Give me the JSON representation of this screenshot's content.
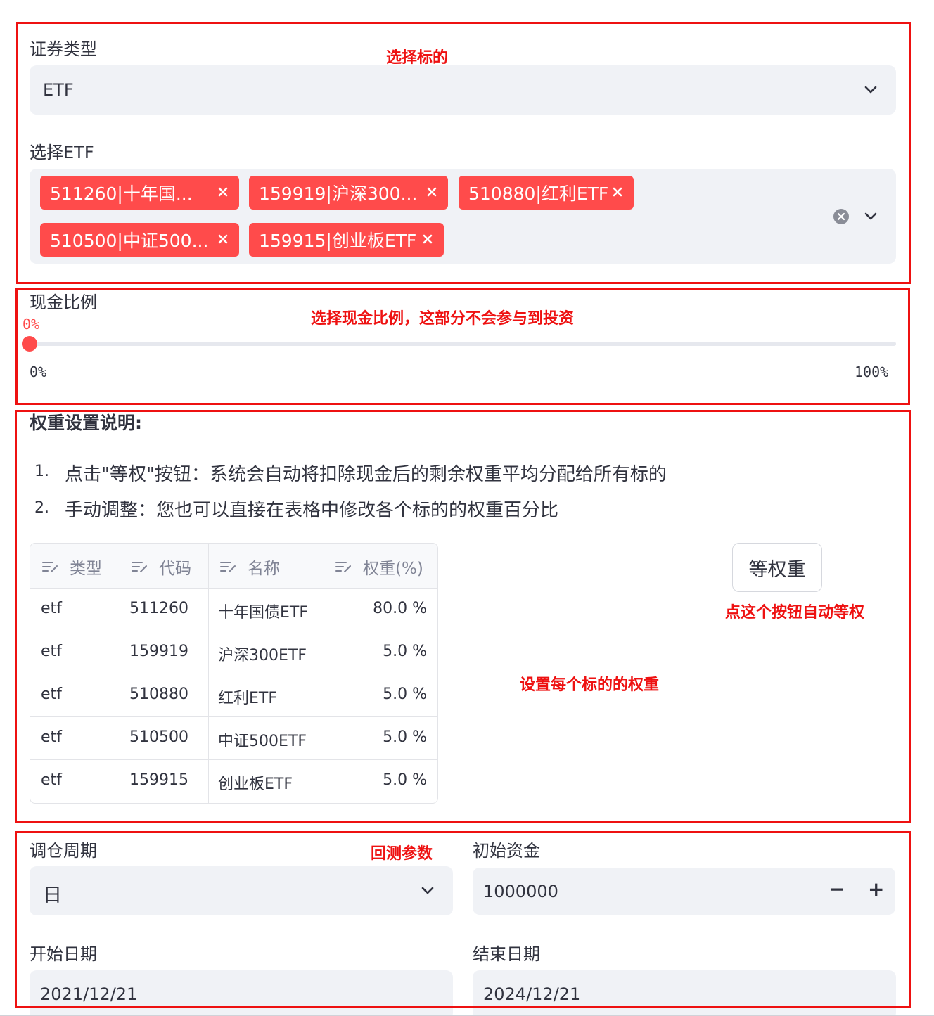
{
  "security_type": {
    "label": "证券类型",
    "value": "ETF"
  },
  "select_etf": {
    "label": "选择ETF",
    "tags": [
      "511260|十年国...",
      "159919|沪深300...",
      "510880|红利ETF",
      "510500|中证500...",
      "159915|创业板ETF"
    ]
  },
  "cash_ratio": {
    "label": "现金比例",
    "current": "0%",
    "min": "0%",
    "max": "100%",
    "value_fraction": 0
  },
  "weight_help": {
    "title": "权重设置说明:",
    "items": [
      "点击\"等权\"按钮：系统会自动将扣除现金后的剩余权重平均分配给所有标的",
      "手动调整：您也可以直接在表格中修改各个标的的权重百分比"
    ],
    "numbers": [
      "1.",
      "2."
    ]
  },
  "weight_table": {
    "columns": [
      "类型",
      "代码",
      "名称",
      "权重(%)"
    ],
    "rows": [
      {
        "type": "etf",
        "code": "511260",
        "name": "十年国债ETF",
        "weight": "80.0 %"
      },
      {
        "type": "etf",
        "code": "159919",
        "name": "沪深300ETF",
        "weight": "5.0 %"
      },
      {
        "type": "etf",
        "code": "510880",
        "name": "红利ETF",
        "weight": "5.0 %"
      },
      {
        "type": "etf",
        "code": "510500",
        "name": "中证500ETF",
        "weight": "5.0 %"
      },
      {
        "type": "etf",
        "code": "159915",
        "name": "创业板ETF",
        "weight": "5.0 %"
      }
    ]
  },
  "equal_weight_button": "等权重",
  "rebalance": {
    "label": "调仓周期",
    "value": "日"
  },
  "initial_capital": {
    "label": "初始资金",
    "value": "1000000",
    "minus": "−",
    "plus": "+"
  },
  "start_date": {
    "label": "开始日期",
    "value": "2021/12/21"
  },
  "end_date": {
    "label": "结束日期",
    "value": "2024/12/21"
  },
  "annotations": {
    "select_target": "选择标的",
    "cash_note": "选择现金比例，这部分不会参与到投资",
    "equal_note": "点这个按钮自动等权",
    "set_weight": "设置每个标的的权重",
    "backtest_params": "回测参数"
  },
  "colors": {
    "accent": "#ff4b4b",
    "annotation": "#ee1111",
    "field_bg": "#f0f2f6"
  }
}
